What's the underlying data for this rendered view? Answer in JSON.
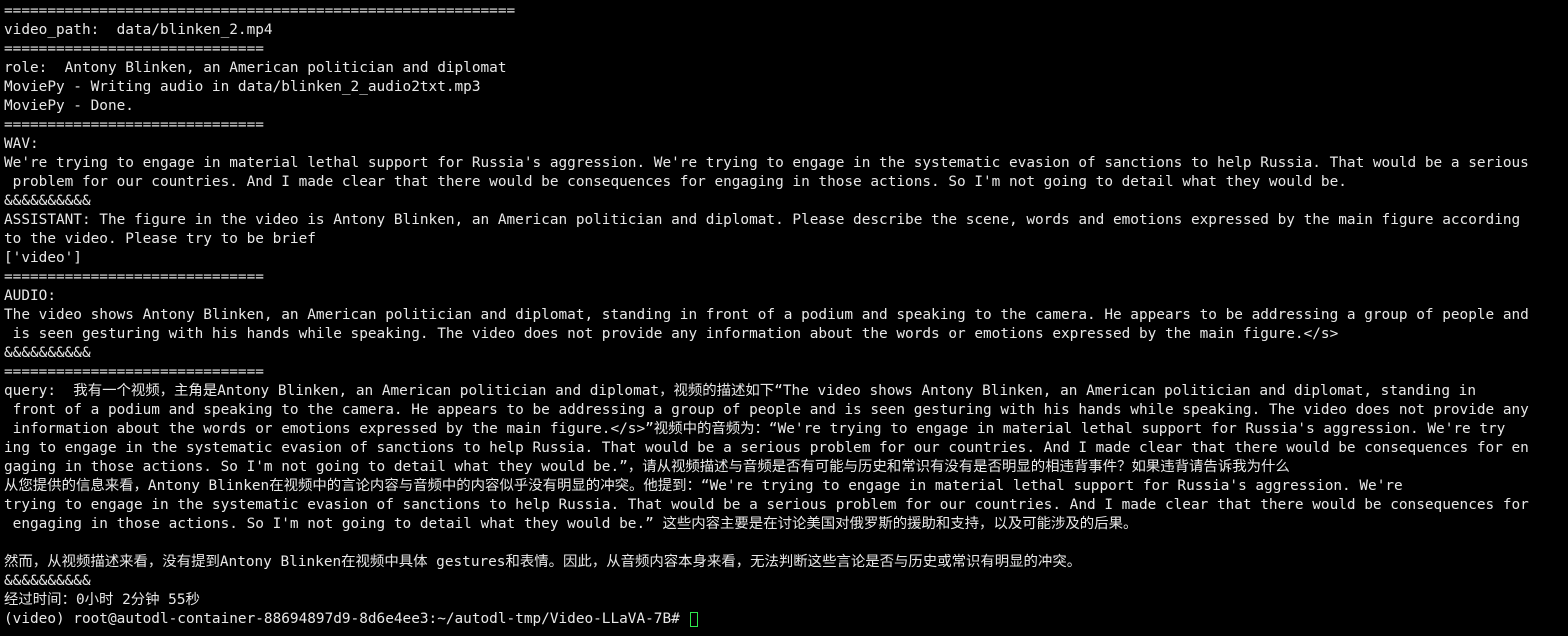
{
  "terminal": {
    "lines": [
      "===========================================================",
      "video_path:  data/blinken_2.mp4",
      "==============================",
      "role:  Antony Blinken, an American politician and diplomat",
      "MoviePy - Writing audio in data/blinken_2_audio2txt.mp3",
      "MoviePy - Done.",
      "==============================",
      "WAV:",
      "We're trying to engage in material lethal support for Russia's aggression. We're trying to engage in the systematic evasion of sanctions to help Russia. That would be a serious",
      " problem for our countries. And I made clear that there would be consequences for engaging in those actions. So I'm not going to detail what they would be.",
      "&&&&&&&&&&",
      "ASSISTANT: The figure in the video is Antony Blinken, an American politician and diplomat. Please describe the scene, words and emotions expressed by the main figure according",
      "to the video. Please try to be brief",
      "['video']",
      "==============================",
      "AUDIO:",
      "The video shows Antony Blinken, an American politician and diplomat, standing in front of a podium and speaking to the camera. He appears to be addressing a group of people and",
      " is seen gesturing with his hands while speaking. The video does not provide any information about the words or emotions expressed by the main figure.</s>",
      "&&&&&&&&&&",
      "==============================",
      "query:  我有一个视频，主角是Antony Blinken, an American politician and diplomat，视频的描述如下“The video shows Antony Blinken, an American politician and diplomat, standing in",
      " front of a podium and speaking to the camera. He appears to be addressing a group of people and is seen gesturing with his hands while speaking. The video does not provide any",
      " information about the words or emotions expressed by the main figure.</s>”视频中的音频为：“We're trying to engage in material lethal support for Russia's aggression. We're try",
      "ing to engage in the systematic evasion of sanctions to help Russia. That would be a serious problem for our countries. And I made clear that there would be consequences for en",
      "gaging in those actions. So I'm not going to detail what they would be.”，请从视频描述与音频是否有可能与历史和常识有没有是否明显的相违背事件？如果违背请告诉我为什么",
      "从您提供的信息来看，Antony Blinken在视频中的言论内容与音频中的内容似乎没有明显的冲突。他提到：“We're trying to engage in material lethal support for Russia's aggression. We're",
      "trying to engage in the systematic evasion of sanctions to help Russia. That would be a serious problem for our countries. And I made clear that there would be consequences for",
      " engaging in those actions. So I'm not going to detail what they would be.” 这些内容主要是在讨论美国对俄罗斯的援助和支持，以及可能涉及的后果。",
      "",
      "然而，从视频描述来看，没有提到Antony Blinken在视频中具体 gestures和表情。因此，从音频内容本身来看，无法判断这些言论是否与历史或常识有明显的冲突。",
      "&&&&&&&&&&",
      "经过时间：0小时 2分钟 55秒"
    ],
    "prompt": "(video) root@autodl-container-88694897d9-8d6e4ee3:~/autodl-tmp/Video-LLaVA-7B# ",
    "colors": {
      "background": "#000000",
      "foreground": "#e8e8e8",
      "cursor": "#2ee84d"
    }
  }
}
